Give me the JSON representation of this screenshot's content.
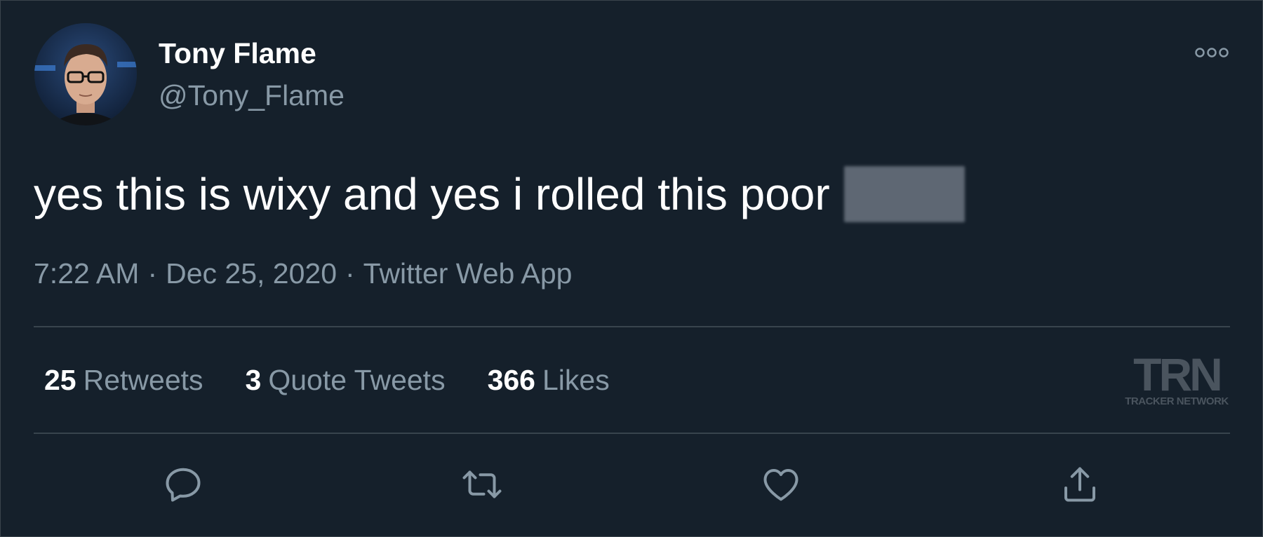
{
  "author": {
    "display_name": "Tony Flame",
    "handle": "@Tony_Flame"
  },
  "tweet": {
    "text": "yes this is wixy and yes i rolled this poor"
  },
  "meta": {
    "time": "7:22 AM",
    "separator": "·",
    "date": "Dec 25, 2020",
    "source": "Twitter Web App"
  },
  "stats": [
    {
      "count": "25",
      "label": "Retweets"
    },
    {
      "count": "3",
      "label": "Quote Tweets"
    },
    {
      "count": "366",
      "label": "Likes"
    }
  ],
  "watermark": {
    "logo": "TRN",
    "name": "TRACKER NETWORK"
  },
  "actions": [
    {
      "icon": "reply-icon"
    },
    {
      "icon": "retweet-icon"
    },
    {
      "icon": "like-icon"
    },
    {
      "icon": "share-icon"
    }
  ],
  "colors": {
    "background": "#15202b",
    "primary_text": "#ffffff",
    "secondary_text": "#8899a6",
    "divider": "#38444d"
  }
}
